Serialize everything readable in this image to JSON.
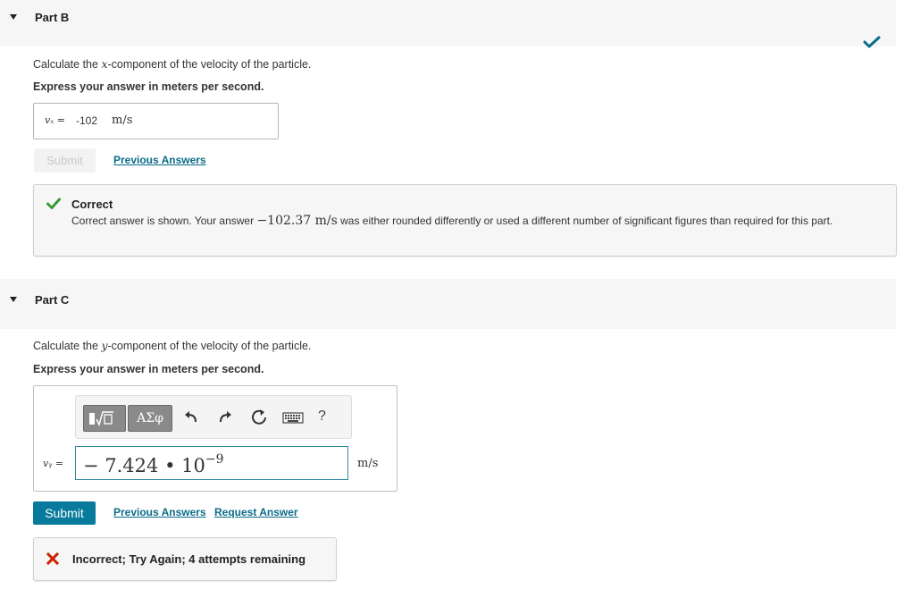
{
  "part_b": {
    "title": "Part B",
    "question_prefix": "Calculate the ",
    "question_var": "x",
    "question_suffix": "-component of the velocity of the particle.",
    "instruction": "Express your answer in meters per second.",
    "answer_var": "vₓ =",
    "answer_value": "-102",
    "answer_unit": "m/s",
    "submit_label": "Submit",
    "previous_answers_label": "Previous Answers",
    "status_icon": "checkmark-icon",
    "feedback": {
      "title": "Correct",
      "body_prefix": "Correct answer is shown. Your answer ",
      "body_value": "−102.37 m/s",
      "body_suffix": " was either rounded differently or used a different number of significant figures than required for this part."
    }
  },
  "part_c": {
    "title": "Part C",
    "question_prefix": "Calculate the ",
    "question_var": "y",
    "question_suffix": "-component of the velocity of the particle.",
    "instruction": "Express your answer in meters per second.",
    "toolbar": {
      "template_icon": "template-fraction-sqrt-icon",
      "symbols_label": "ΑΣφ",
      "help_label": "?"
    },
    "answer_var": "vᵧ =",
    "answer_mantissa": "− 7.424 • 10",
    "answer_exponent": "−9",
    "answer_unit": "m/s",
    "submit_label": "Submit",
    "previous_answers_label": "Previous Answers",
    "request_answer_label": "Request Answer",
    "feedback": {
      "text": "Incorrect; Try Again; 4 attempts remaining"
    }
  },
  "colors": {
    "accent": "#087b9c",
    "link": "#0a6c8a",
    "correct": "#3a9a3a",
    "incorrect": "#cc2200"
  }
}
